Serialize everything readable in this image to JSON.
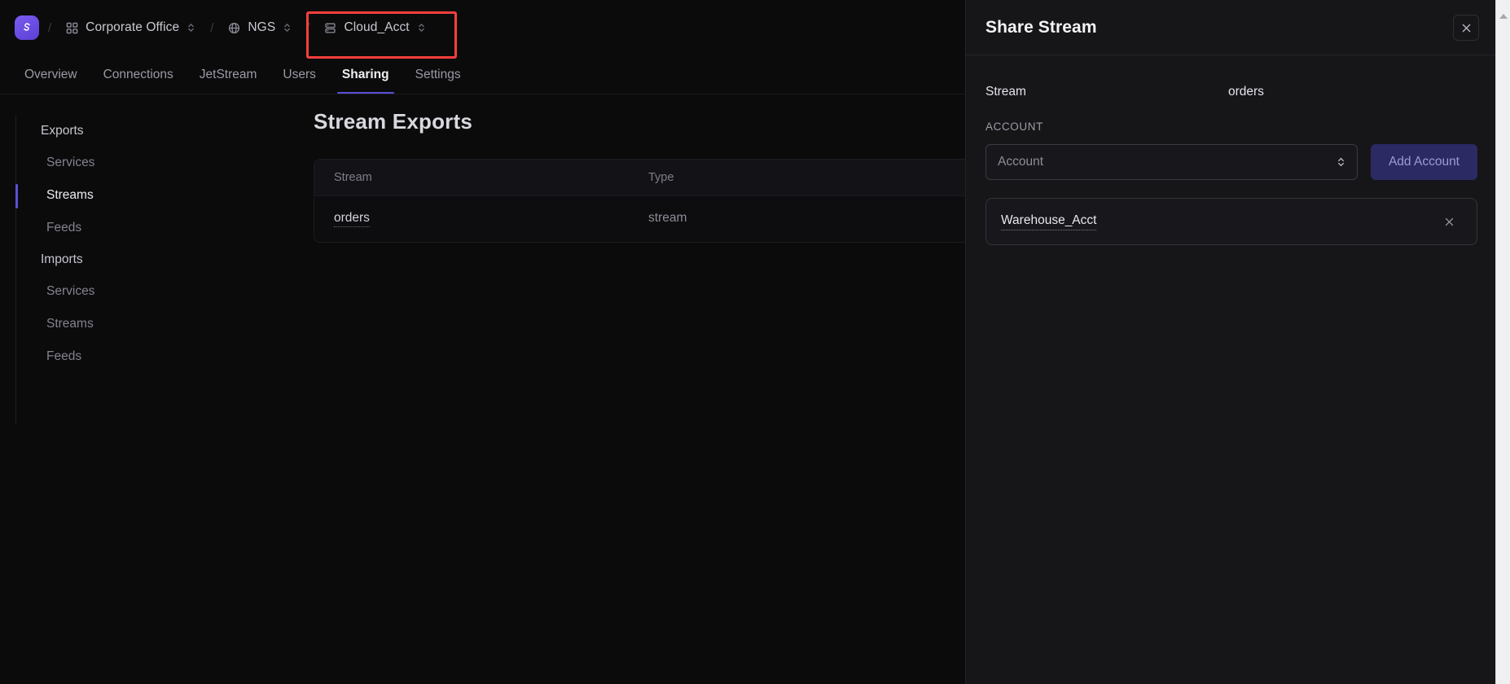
{
  "breadcrumb": {
    "logo_icon": "app-logo-icon",
    "separator": "/",
    "items": [
      {
        "label": "Corporate Office",
        "icon": "grid-icon",
        "chevron": "chevron-updown-icon"
      },
      {
        "label": "NGS",
        "icon": "globe-icon",
        "chevron": "chevron-updown-icon"
      },
      {
        "label": "Cloud_Acct",
        "icon": "server-stack-icon",
        "chevron": "chevron-updown-icon",
        "highlighted": true
      }
    ],
    "highlight_color": "#f8403c"
  },
  "tabs": {
    "items": [
      {
        "label": "Overview",
        "active": false
      },
      {
        "label": "Connections",
        "active": false
      },
      {
        "label": "JetStream",
        "active": false
      },
      {
        "label": "Users",
        "active": false
      },
      {
        "label": "Sharing",
        "active": true
      },
      {
        "label": "Settings",
        "active": false
      }
    ],
    "active_underline_color": "#5b51d8"
  },
  "sidebar": {
    "groups": [
      {
        "label": "Exports",
        "items": [
          {
            "label": "Services",
            "active": false
          },
          {
            "label": "Streams",
            "active": true
          },
          {
            "label": "Feeds",
            "active": false
          }
        ]
      },
      {
        "label": "Imports",
        "items": [
          {
            "label": "Services",
            "active": false
          },
          {
            "label": "Streams",
            "active": false
          },
          {
            "label": "Feeds",
            "active": false
          }
        ]
      }
    ],
    "active_marker_color": "#5b51d8"
  },
  "main": {
    "title": "Stream Exports",
    "table": {
      "columns": [
        "Stream",
        "Type"
      ],
      "rows": [
        {
          "stream": "orders",
          "type": "stream"
        }
      ]
    }
  },
  "drawer": {
    "title": "Share Stream",
    "close_icon": "close-icon",
    "stream_label": "Stream",
    "stream_value": "orders",
    "account_section_label": "ACCOUNT",
    "account_select": {
      "placeholder": "Account",
      "value": "",
      "chevron_icon": "chevron-updown-icon"
    },
    "add_account_label": "Add Account",
    "add_account_disabled": true,
    "accounts": [
      {
        "name": "Warehouse_Acct",
        "remove_icon": "close-icon"
      }
    ]
  },
  "scrollbar": {
    "up_icon": "triangle-up-icon",
    "track_color": "#f0f0f0"
  }
}
